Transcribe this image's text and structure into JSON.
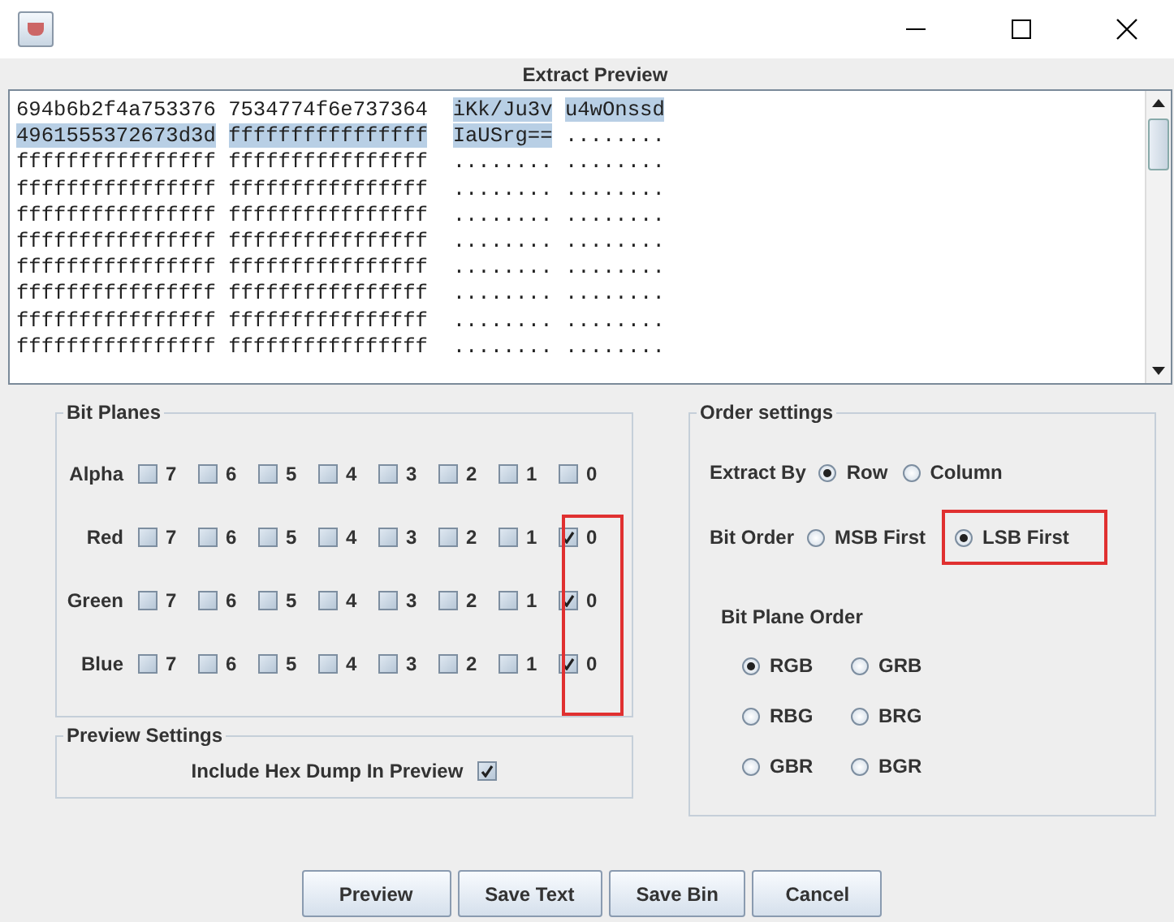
{
  "window": {
    "title": "Extract Preview"
  },
  "preview_lines": [
    [
      {
        "text": "694b6b2f4a753376",
        "selected": false
      },
      {
        "text": "7534774f6e737364",
        "selected": false
      },
      {
        "text": "iKk/Ju3v",
        "selected": true
      },
      {
        "text": "u4wOnssd",
        "selected": true
      }
    ],
    [
      {
        "text": "4961555372673d3d",
        "selected": true
      },
      {
        "text": "ffffffffffffffff",
        "selected": true
      },
      {
        "text": "IaUSrg==",
        "selected": true
      },
      {
        "text": "........",
        "selected": false
      }
    ],
    [
      {
        "text": "ffffffffffffffff",
        "selected": false
      },
      {
        "text": "ffffffffffffffff",
        "selected": false
      },
      {
        "text": "........",
        "selected": false
      },
      {
        "text": "........",
        "selected": false
      }
    ],
    [
      {
        "text": "ffffffffffffffff",
        "selected": false
      },
      {
        "text": "ffffffffffffffff",
        "selected": false
      },
      {
        "text": "........",
        "selected": false
      },
      {
        "text": "........",
        "selected": false
      }
    ],
    [
      {
        "text": "ffffffffffffffff",
        "selected": false
      },
      {
        "text": "ffffffffffffffff",
        "selected": false
      },
      {
        "text": "........",
        "selected": false
      },
      {
        "text": "........",
        "selected": false
      }
    ],
    [
      {
        "text": "ffffffffffffffff",
        "selected": false
      },
      {
        "text": "ffffffffffffffff",
        "selected": false
      },
      {
        "text": "........",
        "selected": false
      },
      {
        "text": "........",
        "selected": false
      }
    ],
    [
      {
        "text": "ffffffffffffffff",
        "selected": false
      },
      {
        "text": "ffffffffffffffff",
        "selected": false
      },
      {
        "text": "........",
        "selected": false
      },
      {
        "text": "........",
        "selected": false
      }
    ],
    [
      {
        "text": "ffffffffffffffff",
        "selected": false
      },
      {
        "text": "ffffffffffffffff",
        "selected": false
      },
      {
        "text": "........",
        "selected": false
      },
      {
        "text": "........",
        "selected": false
      }
    ],
    [
      {
        "text": "ffffffffffffffff",
        "selected": false
      },
      {
        "text": "ffffffffffffffff",
        "selected": false
      },
      {
        "text": "........",
        "selected": false
      },
      {
        "text": "........",
        "selected": false
      }
    ],
    [
      {
        "text": "ffffffffffffffff",
        "selected": false
      },
      {
        "text": "ffffffffffffffff",
        "selected": false
      },
      {
        "text": "........",
        "selected": false
      },
      {
        "text": "........",
        "selected": false
      }
    ]
  ],
  "bit_planes": {
    "title": "Bit Planes",
    "marked_last_column": true,
    "rows": [
      {
        "label": "Alpha",
        "bits": [
          {
            "label": "7",
            "checked": false
          },
          {
            "label": "6",
            "checked": false
          },
          {
            "label": "5",
            "checked": false
          },
          {
            "label": "4",
            "checked": false
          },
          {
            "label": "3",
            "checked": false
          },
          {
            "label": "2",
            "checked": false
          },
          {
            "label": "1",
            "checked": false
          },
          {
            "label": "0",
            "checked": false
          }
        ]
      },
      {
        "label": "Red",
        "bits": [
          {
            "label": "7",
            "checked": false
          },
          {
            "label": "6",
            "checked": false
          },
          {
            "label": "5",
            "checked": false
          },
          {
            "label": "4",
            "checked": false
          },
          {
            "label": "3",
            "checked": false
          },
          {
            "label": "2",
            "checked": false
          },
          {
            "label": "1",
            "checked": false
          },
          {
            "label": "0",
            "checked": true
          }
        ]
      },
      {
        "label": "Green",
        "bits": [
          {
            "label": "7",
            "checked": false
          },
          {
            "label": "6",
            "checked": false
          },
          {
            "label": "5",
            "checked": false
          },
          {
            "label": "4",
            "checked": false
          },
          {
            "label": "3",
            "checked": false
          },
          {
            "label": "2",
            "checked": false
          },
          {
            "label": "1",
            "checked": false
          },
          {
            "label": "0",
            "checked": true
          }
        ]
      },
      {
        "label": "Blue",
        "bits": [
          {
            "label": "7",
            "checked": false
          },
          {
            "label": "6",
            "checked": false
          },
          {
            "label": "5",
            "checked": false
          },
          {
            "label": "4",
            "checked": false
          },
          {
            "label": "3",
            "checked": false
          },
          {
            "label": "2",
            "checked": false
          },
          {
            "label": "1",
            "checked": false
          },
          {
            "label": "0",
            "checked": true
          }
        ]
      }
    ]
  },
  "preview_settings": {
    "title": "Preview Settings",
    "hex_dump": {
      "label": "Include Hex Dump In Preview",
      "checked": true
    }
  },
  "order_settings": {
    "title": "Order settings",
    "extract_by": {
      "label": "Extract By",
      "options": [
        {
          "label": "Row",
          "selected": true
        },
        {
          "label": "Column",
          "selected": false
        }
      ]
    },
    "bit_order": {
      "label": "Bit Order",
      "options": [
        {
          "label": "MSB First",
          "selected": false,
          "marked": false
        },
        {
          "label": "LSB First",
          "selected": true,
          "marked": true
        }
      ]
    },
    "bit_plane_order": {
      "label": "Bit Plane Order",
      "options": [
        {
          "label": "RGB",
          "selected": true
        },
        {
          "label": "GRB",
          "selected": false
        },
        {
          "label": "RBG",
          "selected": false
        },
        {
          "label": "BRG",
          "selected": false
        },
        {
          "label": "GBR",
          "selected": false
        },
        {
          "label": "BGR",
          "selected": false
        }
      ]
    }
  },
  "buttons": [
    "Preview",
    "Save Text",
    "Save Bin",
    "Cancel"
  ]
}
